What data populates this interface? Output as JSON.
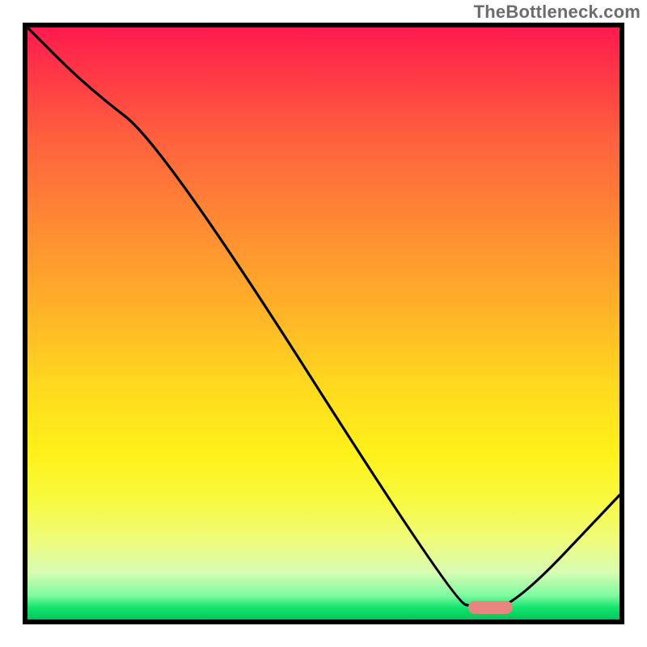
{
  "watermark": "TheBottleneck.com",
  "chart_data": {
    "type": "line",
    "title": "",
    "xlabel": "",
    "ylabel": "",
    "xlim": [
      0,
      100
    ],
    "ylim": [
      0,
      100
    ],
    "grid": false,
    "legend": false,
    "series": [
      {
        "name": "bottleneck-curve",
        "x": [
          0,
          10,
          23,
          72,
          76,
          82,
          100
        ],
        "y": [
          100,
          90,
          80,
          3,
          2,
          2,
          21
        ]
      }
    ],
    "marker": {
      "name": "target-range",
      "x_start": 74.5,
      "x_end": 82,
      "y": 2,
      "color": "#e9857f"
    },
    "background_gradient": {
      "top": "#ff1a4e",
      "mid": "#ffd81f",
      "bottom": "#03c65b",
      "meaning": "bottleneck severity (red=high, green=low)"
    }
  }
}
